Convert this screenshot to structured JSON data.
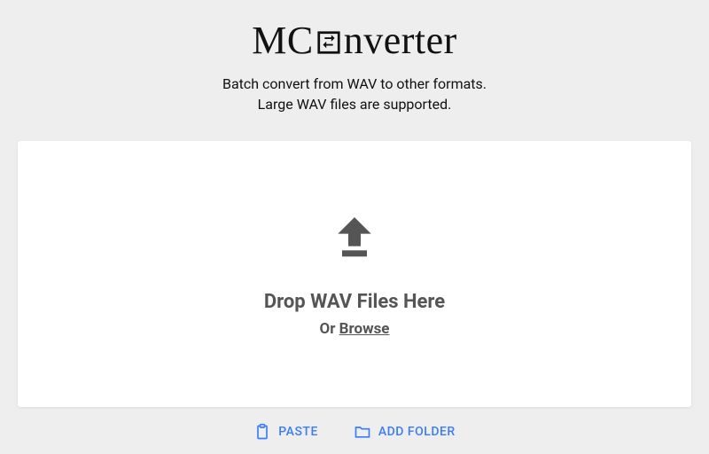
{
  "header": {
    "logo_prefix": "MC",
    "logo_suffix": "nverter",
    "subtitle_line1": "Batch convert from WAV to other formats.",
    "subtitle_line2": "Large WAV files are supported."
  },
  "dropzone": {
    "heading": "Drop WAV Files Here",
    "or_text": "Or ",
    "browse_text": "Browse"
  },
  "actions": {
    "paste_label": "PASTE",
    "add_folder_label": "ADD FOLDER"
  }
}
